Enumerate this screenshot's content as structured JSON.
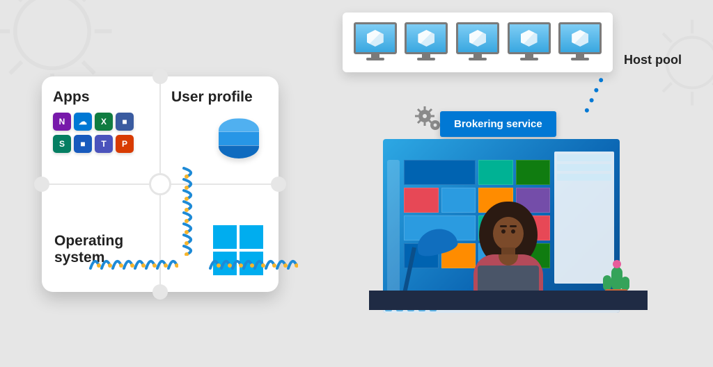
{
  "labels": {
    "apps_heading": "Apps",
    "user_profile_heading": "User profile",
    "os_heading": "Operating system",
    "host_pool": "Host pool",
    "brokering": "Brokering service"
  },
  "icon_names": {
    "cloud_box": "cloud-vm-icon",
    "database": "database-icon",
    "windows": "windows-logo-icon",
    "gear_small": "gear-icon",
    "lamp": "desk-lamp-icon",
    "cactus": "cactus-icon",
    "laptop": "laptop-icon",
    "person": "user-figure-icon"
  },
  "apps_row1": [
    "N",
    "☁",
    "X",
    "■"
  ],
  "apps_row2": [
    "S",
    "■",
    "T",
    "P"
  ],
  "host_count": 5
}
